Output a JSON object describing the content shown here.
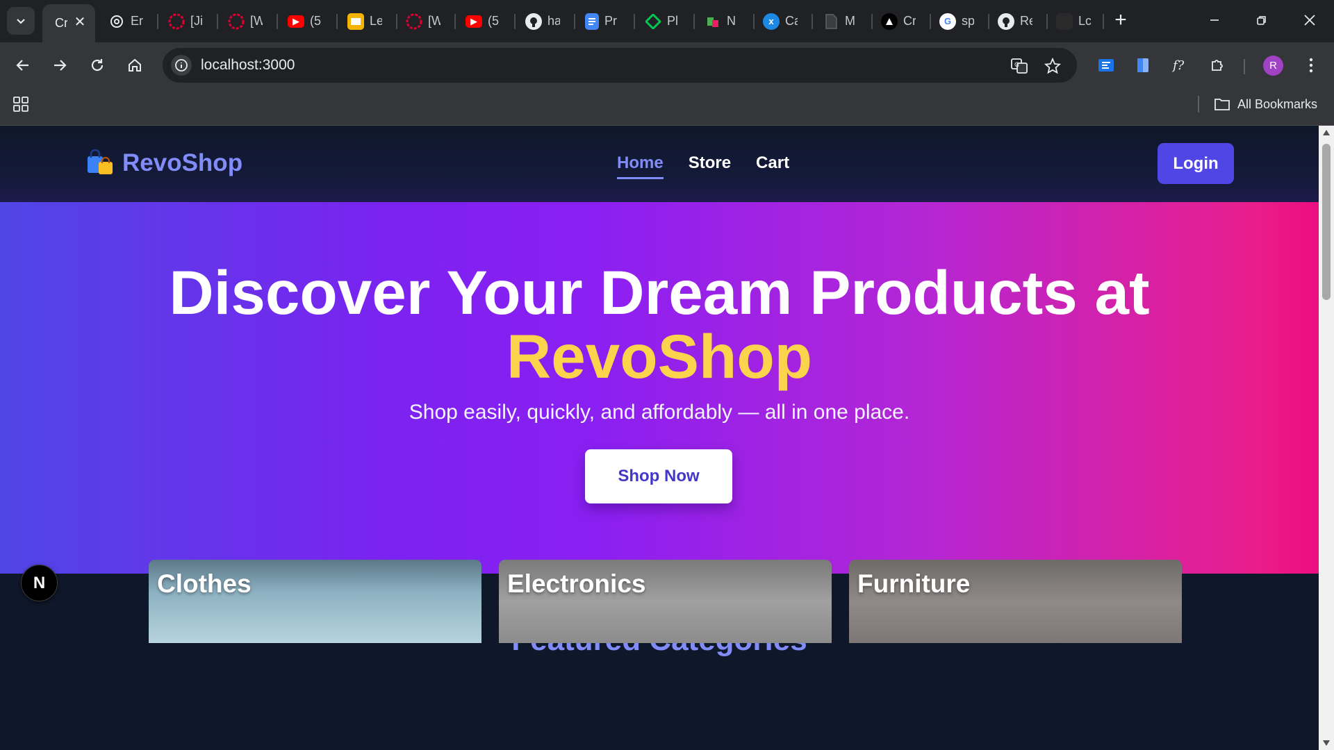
{
  "browser": {
    "tabs": [
      {
        "title": "Cr",
        "icon": "page-icon",
        "color": "#35363a"
      },
      {
        "title": "Er",
        "icon": "openai-icon",
        "color": "#e8eaed"
      },
      {
        "title": "[Ji",
        "icon": "angular-icon",
        "color": "#dd0031"
      },
      {
        "title": "[W",
        "icon": "angular-icon",
        "color": "#dd0031"
      },
      {
        "title": "(5",
        "icon": "youtube-icon",
        "color": "#ff0000"
      },
      {
        "title": "Le",
        "icon": "slides-icon",
        "color": "#f4b400"
      },
      {
        "title": "[W",
        "icon": "angular-icon",
        "color": "#dd0031"
      },
      {
        "title": "(5",
        "icon": "youtube-icon",
        "color": "#ff0000"
      },
      {
        "title": "ha",
        "icon": "github-icon",
        "color": "#e8eaed"
      },
      {
        "title": "Pr",
        "icon": "docs-icon",
        "color": "#4285f4"
      },
      {
        "title": "Pl",
        "icon": "diamond-icon",
        "color": "#00c853"
      },
      {
        "title": "N",
        "icon": "app-icon",
        "color": "#e91e63"
      },
      {
        "title": "Ca",
        "icon": "translate-icon",
        "color": "#1e88e5"
      },
      {
        "title": "M",
        "icon": "doc-icon",
        "color": "#5f6368"
      },
      {
        "title": "Cr",
        "icon": "triangle-icon",
        "color": "#000000"
      },
      {
        "title": "sp",
        "icon": "google-icon",
        "color": "#ffffff"
      },
      {
        "title": "Re",
        "icon": "github-icon",
        "color": "#e8eaed"
      },
      {
        "title": "Lc",
        "icon": "page-icon",
        "color": "#2a2a2a"
      }
    ],
    "url": "localhost:3000",
    "avatar_letter": "R",
    "bookmarks_label": "All Bookmarks"
  },
  "site": {
    "brand": "RevoShop",
    "nav": [
      {
        "label": "Home",
        "active": true
      },
      {
        "label": "Store",
        "active": false
      },
      {
        "label": "Cart",
        "active": false
      }
    ],
    "login_label": "Login",
    "hero": {
      "title_line1": "Discover Your Dream Products at",
      "title_accent": "RevoShop",
      "subtitle": "Shop easily, quickly, and affordably — all in one place.",
      "cta": "Shop Now"
    },
    "categories_title": "Featured Categories",
    "categories": [
      "Clothes",
      "Electronics",
      "Furniture"
    ],
    "dev_badge": "N",
    "colors": {
      "accent": "#818cf8",
      "primary": "#4f46e5",
      "highlight": "#fcd34d",
      "background": "#0f172a"
    }
  }
}
